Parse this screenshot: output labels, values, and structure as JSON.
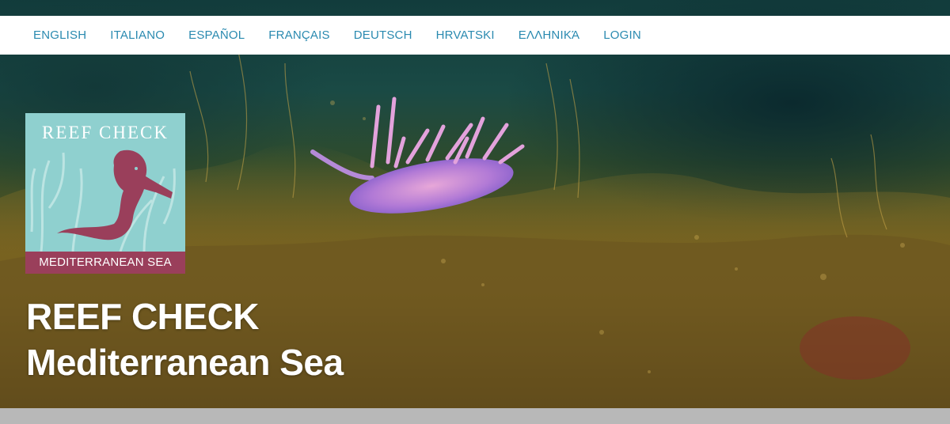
{
  "nav": {
    "items": [
      {
        "label": "ENGLISH"
      },
      {
        "label": "ITALIANO"
      },
      {
        "label": "ESPAÑOL"
      },
      {
        "label": "FRANÇAIS"
      },
      {
        "label": "DEUTSCH"
      },
      {
        "label": "HRVATSKI"
      },
      {
        "label": "ΕΛΛΗΝΙΚΆ"
      },
      {
        "label": "LOGIN"
      }
    ]
  },
  "logo": {
    "title": "REEF CHECK",
    "subtitle": "MEDITERRANEAN SEA",
    "background_color": "#8fd0cf",
    "band_color": "#9a3f5b",
    "icon": "seahorse-icon"
  },
  "hero": {
    "title_line1": "REEF CHECK",
    "title_line2": "Mediterranean Sea",
    "image": "nudibranch-on-algae-photo"
  },
  "colors": {
    "nav_link": "#2a8ab0",
    "nav_background": "#ffffff",
    "footer_strip": "#b8b8b8"
  }
}
